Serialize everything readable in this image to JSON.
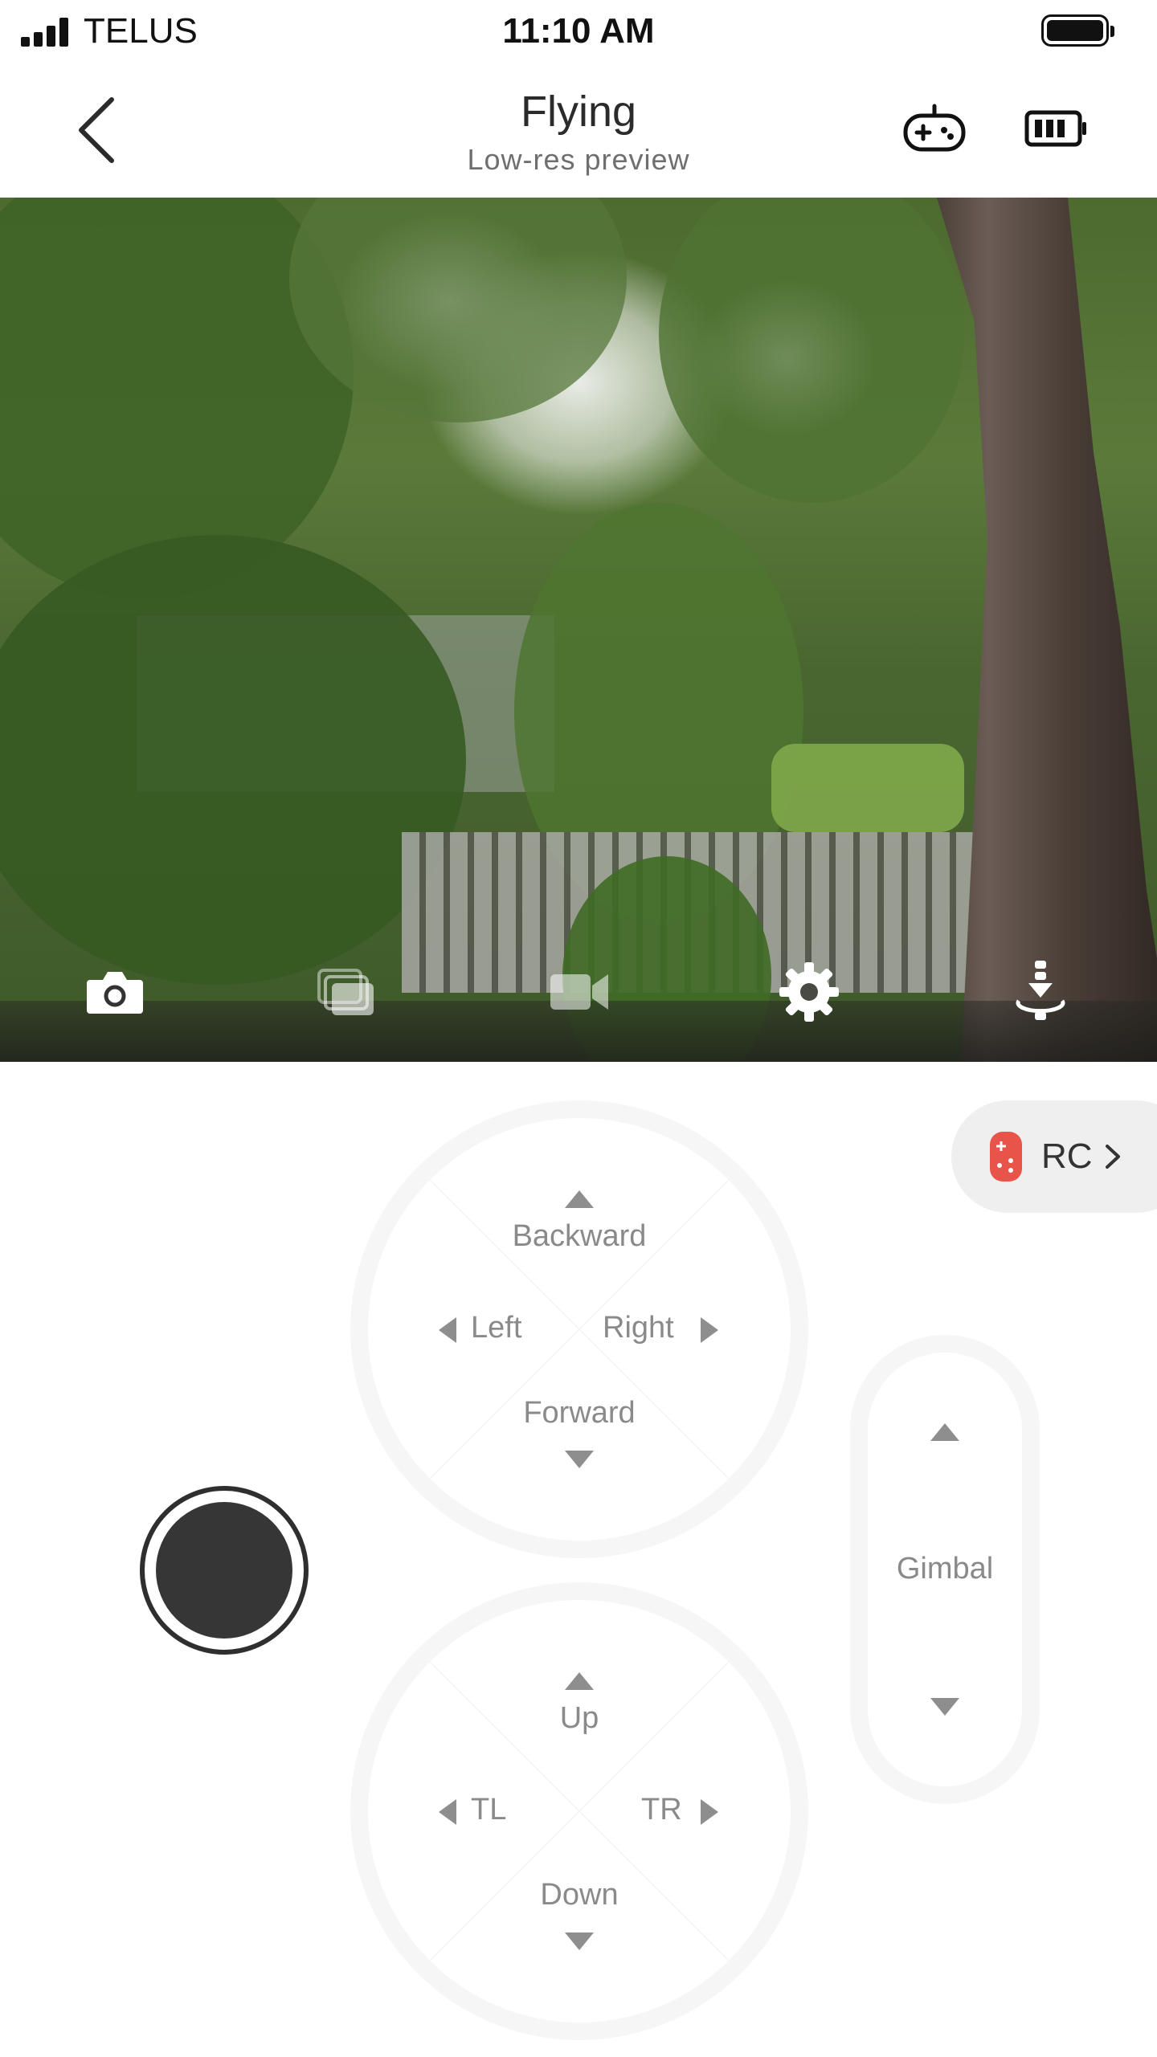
{
  "status_bar": {
    "carrier": "TELUS",
    "time": "11:10 AM"
  },
  "header": {
    "title": "Flying",
    "subtitle": "Low-res preview",
    "icons": [
      "back-chevron-icon",
      "gamepad-icon",
      "battery-icon"
    ]
  },
  "camera_toolbar": {
    "icons": [
      "camera-icon",
      "gallery-icon",
      "video-icon",
      "settings-icon",
      "land-icon"
    ]
  },
  "rc_button": {
    "label": "RC"
  },
  "movement_pad": {
    "up": "Backward",
    "left": "Left",
    "right": "Right",
    "down": "Forward"
  },
  "altitude_pad": {
    "up": "Up",
    "left": "TL",
    "right": "TR",
    "down": "Down"
  },
  "gimbal": {
    "label": "Gimbal"
  },
  "colors": {
    "accent_red": "#e8534a",
    "shutter": "#363636",
    "label_gray": "#8a8a8a"
  }
}
